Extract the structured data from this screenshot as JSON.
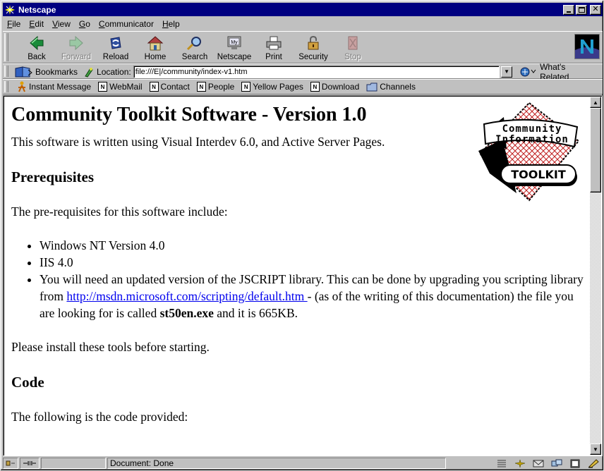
{
  "window": {
    "title": "Netscape"
  },
  "menu": [
    {
      "key": "F",
      "rest": "ile"
    },
    {
      "key": "E",
      "rest": "dit"
    },
    {
      "key": "V",
      "rest": "iew"
    },
    {
      "key": "G",
      "rest": "o"
    },
    {
      "key": "C",
      "rest": "ommunicator"
    },
    {
      "key": "H",
      "rest": "elp"
    }
  ],
  "nav": {
    "back": "Back",
    "forward": "Forward",
    "reload": "Reload",
    "home": "Home",
    "search": "Search",
    "netscape": "Netscape",
    "print": "Print",
    "security": "Security",
    "stop": "Stop",
    "netscape_icon_text": "My"
  },
  "location": {
    "bookmarks": "Bookmarks",
    "label": "Location:",
    "url": "file:///E|/community/index-v1.htm",
    "whats_related": "What's Related"
  },
  "personal": {
    "instant_message": "Instant Message",
    "webmail": "WebMail",
    "contact": "Contact",
    "people": "People",
    "yellow_pages": "Yellow Pages",
    "download": "Download",
    "channels": "Channels"
  },
  "page": {
    "title": "Community Toolkit Software - Version 1.0",
    "intro": "This software is written using Visual Interdev 6.0, and Active Server Pages.",
    "h_prereq": "Prerequisites",
    "prereq_intro": "The pre-requisites for this software include:",
    "item1": "Windows NT Version 4.0",
    "item2": "IIS 4.0",
    "item3_pre": "You will need an updated version of the JSCRIPT library. This can be done by upgrading you scripting library from ",
    "item3_link": "http://msdn.microsoft.com/scripting/default.htm ",
    "item3_mid": "- (as of the writing of this documentation) the file you are looking for is called ",
    "item3_bold": "st50en.exe",
    "item3_post": " and it is 665KB.",
    "install": "Please install these tools before starting.",
    "h_code": "Code",
    "code_intro": "The following is the code provided:",
    "logo": {
      "line1": "Community",
      "line2": "Information",
      "line3": "TOOLKIT"
    }
  },
  "status": {
    "text": "Document: Done"
  },
  "colors": {
    "titlebar": "#000080",
    "link": "#0000ee",
    "chrome": "#c0c0c0"
  }
}
